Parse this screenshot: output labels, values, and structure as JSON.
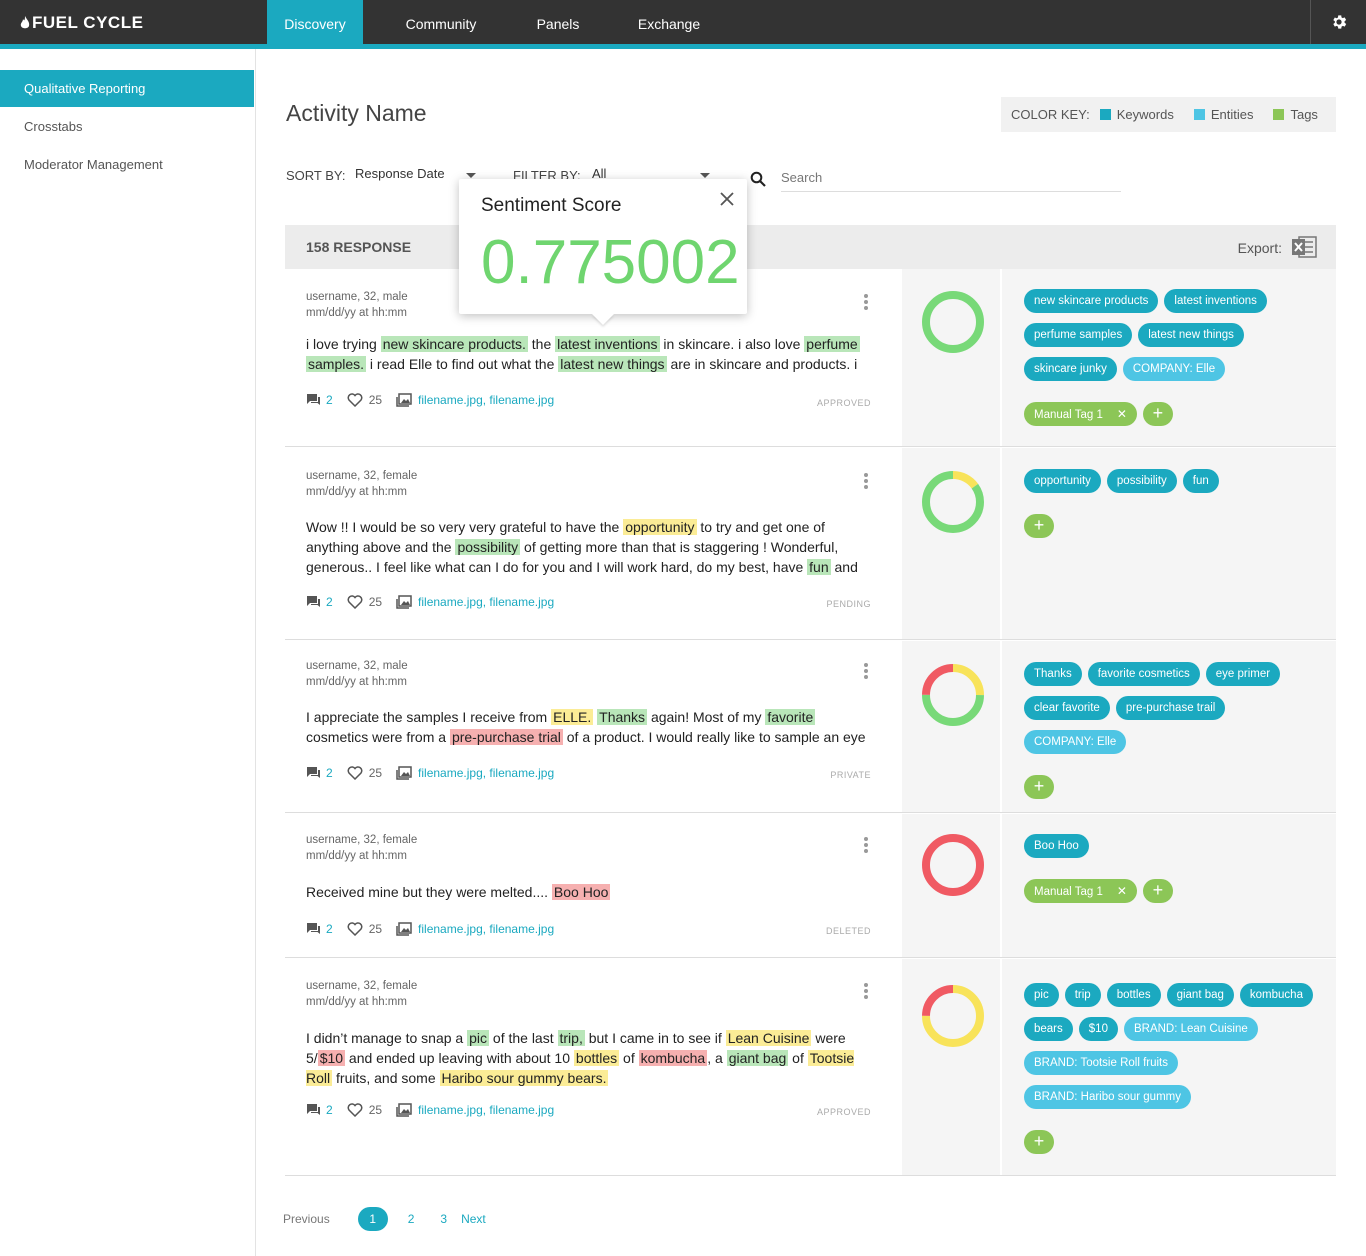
{
  "brand": {
    "logo": "FUEL CYCLE"
  },
  "nav": {
    "tabs": [
      "Discovery",
      "Community",
      "Panels",
      "Exchange"
    ]
  },
  "sidebar": {
    "items": [
      "Qualitative Reporting",
      "Crosstabs",
      "Moderator Management"
    ]
  },
  "page_title": "Activity Name",
  "color_key": {
    "label": "COLOR KEY:",
    "keywords": "Keywords",
    "entities": "Entities",
    "tags": "Tags",
    "colors": {
      "keywords": "#1ba9c0",
      "entities": "#4ec5e4",
      "tags": "#8cc657"
    }
  },
  "toolbar": {
    "sort_label": "SORT BY:",
    "sort_value": "Response Date",
    "filter_label": "FILTER BY:",
    "filter_value": "All",
    "search_placeholder": "Search"
  },
  "responses_header": {
    "count": "158 RESPONSE",
    "export_label": "Export:"
  },
  "popover": {
    "title": "Sentiment Score",
    "score": "0.775002"
  },
  "rows": [
    {
      "user": "username, 32, male",
      "date": "mm/dd/yy at hh:mm",
      "comments": "2",
      "likes": "25",
      "files": "filename.jpg, filename.jpg",
      "status": "APPROVED",
      "tags": {
        "keywords": [
          "new skincare products",
          "latest inventions",
          "perfume samples",
          "latest new things",
          "skincare junky"
        ],
        "entities": [
          "COMPANY: Elle"
        ],
        "manual": [
          "Manual Tag 1"
        ]
      }
    },
    {
      "user": "username, 32, female",
      "date": "mm/dd/yy at hh:mm",
      "comments": "2",
      "likes": "25",
      "files": "filename.jpg, filename.jpg",
      "status": "PENDING",
      "tags": {
        "keywords": [
          "opportunity",
          "possibility",
          "fun"
        ],
        "entities": [],
        "manual": []
      }
    },
    {
      "user": "username, 32, male",
      "date": "mm/dd/yy at hh:mm",
      "comments": "2",
      "likes": "25",
      "files": "filename.jpg, filename.jpg",
      "status": "PRIVATE",
      "tags": {
        "keywords": [
          "Thanks",
          "favorite cosmetics",
          "eye primer",
          "clear favorite",
          "pre-purchase trail"
        ],
        "entities": [
          "COMPANY: Elle"
        ],
        "manual": []
      }
    },
    {
      "user": "username, 32, female",
      "date": "mm/dd/yy at hh:mm",
      "comments": "2",
      "likes": "25",
      "files": "filename.jpg, filename.jpg",
      "status": "DELETED",
      "tags": {
        "keywords": [
          "Boo Hoo"
        ],
        "entities": [],
        "manual": [
          "Manual Tag 1"
        ]
      }
    },
    {
      "user": "username, 32, female",
      "date": "mm/dd/yy at hh:mm",
      "comments": "2",
      "likes": "25",
      "files": "filename.jpg, filename.jpg",
      "status": "APPROVED",
      "tags": {
        "keywords": [
          "pic",
          "trip",
          "bottles",
          "giant bag",
          "kombucha",
          "bears",
          "$10"
        ],
        "entities": [
          "BRAND: Lean Cuisine",
          "BRAND: Tootsie Roll fruits",
          "BRAND: Haribo sour gummy"
        ],
        "manual": []
      }
    }
  ],
  "texts": {
    "r1": [
      "i love trying ",
      "new skincare products.",
      " the ",
      "latest inventions",
      " in skincare. i also love ",
      "perfume",
      " ",
      "samples.",
      " i read Elle to find out what the ",
      "latest new things",
      " are in skincare and products. i am"
    ],
    "r2": [
      "Wow !! I would be so very very grateful to have the ",
      "opportunity",
      " to try and get one of anything above and the ",
      "possibility",
      " of getting more than that is staggering ! Wonderful, generous.. I feel like what can I do for you and I will work hard, do my best, have ",
      "fun",
      " and be"
    ],
    "r3": [
      "I appreciate the samples I receive from ",
      "ELLE.",
      " ",
      "Thanks",
      " again! Most of my ",
      "favorite",
      " cosmetics were from a ",
      "pre-purchase trial",
      " of a product. I would really like to sample an eye primer. I"
    ],
    "r4": [
      "Received mine but they were melted.... ",
      "Boo Hoo"
    ],
    "r5": [
      "I didn’t manage to snap a ",
      "pic",
      " of the last ",
      "trip,",
      " but I came in to see if ",
      "Lean Cuisine",
      " were 5/",
      "$10",
      " and ended up leaving with about 10 ",
      "bottles",
      " of ",
      "kombucha",
      ", a ",
      "giant bag",
      " of ",
      "Tootsie Roll",
      " fruits, and some ",
      "Haribo sour gummy bears."
    ]
  },
  "sentiment": [
    {
      "green": 1.0,
      "yellow": 0.0,
      "red": 0.0
    },
    {
      "green": 0.85,
      "yellow": 0.15,
      "red": 0.0
    },
    {
      "green": 0.5,
      "yellow": 0.25,
      "red": 0.25
    },
    {
      "green": 0.0,
      "yellow": 0.0,
      "red": 1.0
    },
    {
      "green": 0.0,
      "yellow": 0.75,
      "red": 0.25
    }
  ],
  "pagination": {
    "prev": "Previous",
    "pages": [
      "1",
      "2",
      "3"
    ],
    "next": "Next"
  }
}
